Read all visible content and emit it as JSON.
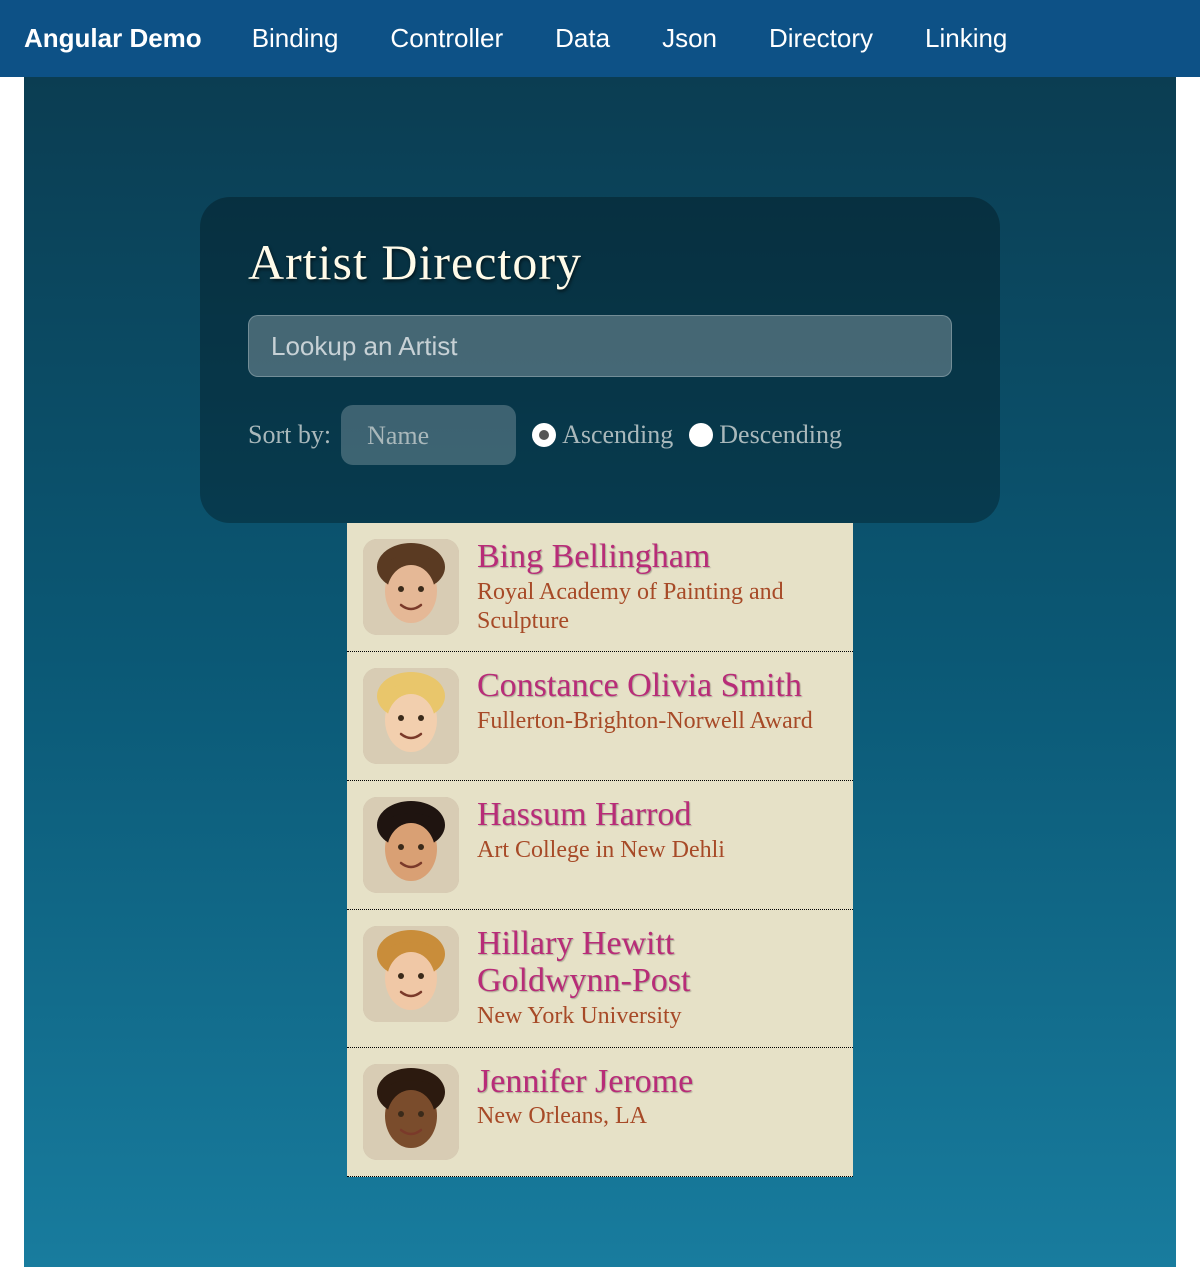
{
  "navbar": {
    "brand": "Angular Demo",
    "links": [
      "Binding",
      "Controller",
      "Data",
      "Json",
      "Directory",
      "Linking"
    ]
  },
  "search": {
    "title": "Artist Directory",
    "placeholder": "Lookup an Artist"
  },
  "sort": {
    "label": "Sort by:",
    "selected": "Name",
    "asc_label": "Ascending",
    "desc_label": "Descending",
    "direction": "asc"
  },
  "artists": [
    {
      "name": "Bing Bellingham",
      "sub": "Royal Academy of Painting and Sculpture",
      "skin": "#e5b896",
      "hair": "#5a3a22"
    },
    {
      "name": "Constance Olivia Smith",
      "sub": "Fullerton-Brighton-Norwell Award",
      "skin": "#f2cfae",
      "hair": "#e9c66b"
    },
    {
      "name": "Hassum Harrod",
      "sub": "Art College in New Dehli",
      "skin": "#d9a074",
      "hair": "#1f1410"
    },
    {
      "name": "Hillary Hewitt Goldwynn-Post",
      "sub": "New York University",
      "skin": "#f0c8a6",
      "hair": "#c98d3a"
    },
    {
      "name": "Jennifer Jerome",
      "sub": "New Orleans, LA",
      "skin": "#7a4c2c",
      "hair": "#2c1a0f"
    }
  ]
}
